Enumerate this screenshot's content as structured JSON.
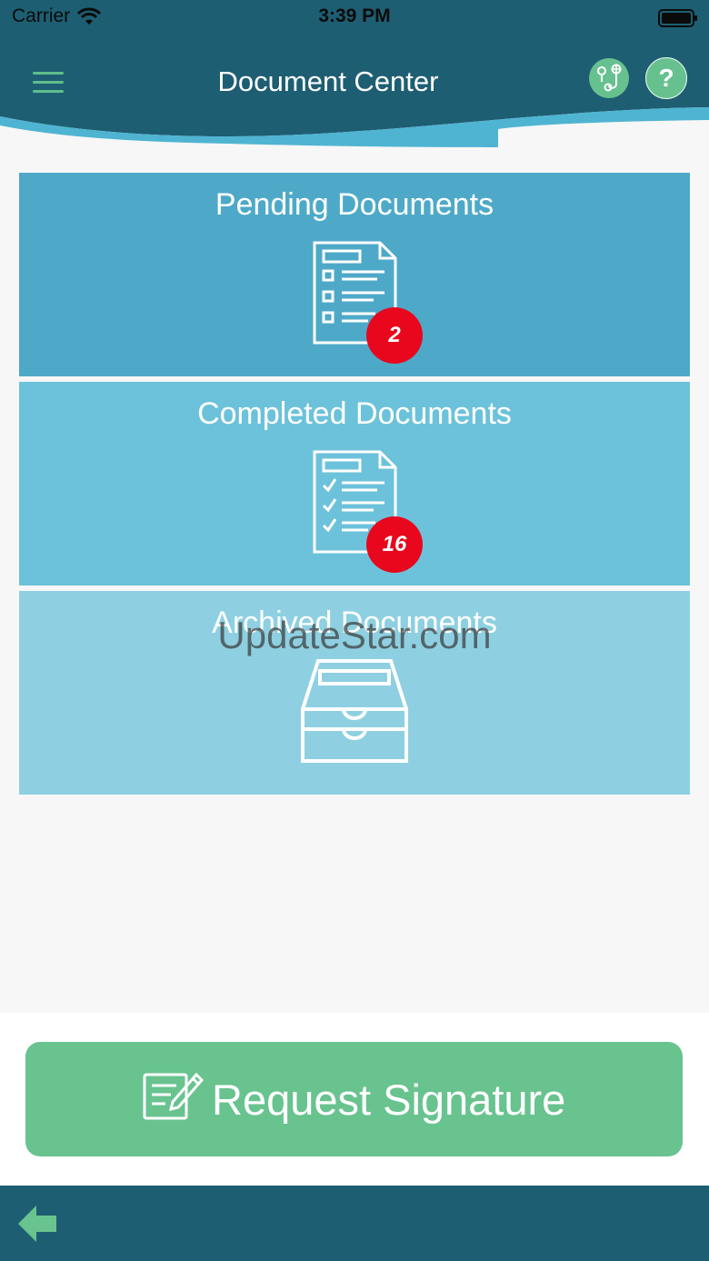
{
  "status_bar": {
    "carrier": "Carrier",
    "time": "3:39 PM"
  },
  "header": {
    "title": "Document Center",
    "menu_icon": "hamburger-menu-icon",
    "map_icon": "map-pins-icon",
    "help_icon": "help-icon",
    "help_glyph": "?"
  },
  "cards": [
    {
      "label": "Pending Documents",
      "icon": "checklist-document-icon",
      "count": "2"
    },
    {
      "label": "Completed Documents",
      "icon": "checked-document-icon",
      "count": "16"
    },
    {
      "label": "Archived Documents",
      "icon": "archive-drawer-icon"
    }
  ],
  "watermark": "UpdateStar.com",
  "request_button": {
    "label": "Request Signature",
    "icon": "sign-document-icon"
  },
  "bottom_bar": {
    "back_icon": "back-arrow-icon"
  },
  "colors": {
    "header": "#1e5e72",
    "wave": "#4fb4d2",
    "accent_green": "#68c38f",
    "pending": "#4ea9c8",
    "completed": "#6cc2da",
    "archived": "#8ed0e1",
    "badge": "#e8071d"
  }
}
